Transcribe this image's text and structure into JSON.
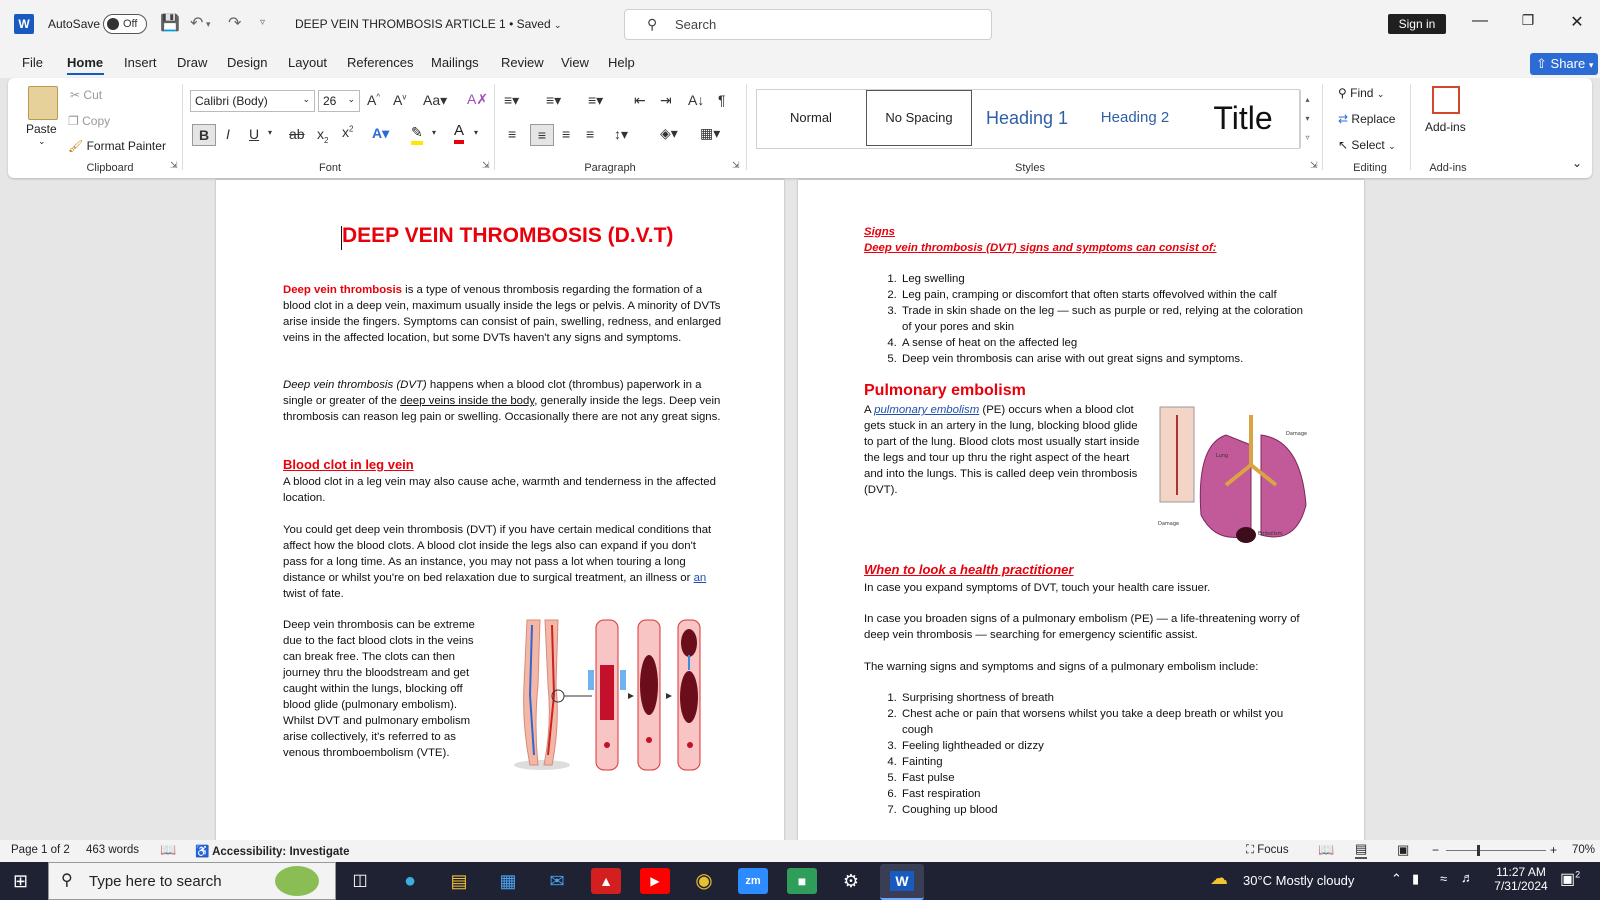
{
  "titlebar": {
    "autosave_label": "AutoSave",
    "autosave_state": "Off",
    "doc_title": "DEEP VEIN THROMBOSIS ARTICLE 1 • Saved",
    "search_placeholder": "Search",
    "signin": "Sign in"
  },
  "menu": [
    "File",
    "Home",
    "Insert",
    "Draw",
    "Design",
    "Layout",
    "References",
    "Mailings",
    "Review",
    "View",
    "Help"
  ],
  "share": "Share",
  "ribbon": {
    "clipboard": {
      "paste": "Paste",
      "cut": "Cut",
      "copy": "Copy",
      "format_painter": "Format Painter",
      "label": "Clipboard"
    },
    "font": {
      "name": "Calibri (Body)",
      "size": "26",
      "label": "Font"
    },
    "paragraph": {
      "label": "Paragraph"
    },
    "styles": {
      "items": [
        "Normal",
        "No Spacing",
        "Heading 1",
        "Heading 2",
        "Title"
      ],
      "label": "Styles"
    },
    "editing": {
      "find": "Find",
      "replace": "Replace",
      "select": "Select",
      "label": "Editing"
    },
    "addins": {
      "button": "Add-ins",
      "label": "Add-ins"
    }
  },
  "page1": {
    "title": "DEEP VEIN THROMBOSIS (D.V.T)",
    "p1_lead": "Deep vein thrombosis",
    "p1_rest": " is a type of venous thrombosis regarding the formation of a blood clot in a deep vein, maximum usually inside the legs or pelvis. A minority of DVTs arise inside the fingers. Symptoms can consist of pain, swelling, redness, and enlarged veins in the affected location, but some DVTs haven't any signs and symptoms.",
    "p2_italic": "Deep vein thrombosis (DVT)",
    "p2_a": " happens when a blood clot (thrombus) paperwork in a single or greater of the ",
    "p2_link": "deep veins inside the body",
    "p2_b": ", generally inside the legs. Deep vein thrombosis can reason leg pain or swelling. Occasionally there are not any great signs.",
    "h_clot": "Blood clot in leg vein",
    "p3": "A blood clot in a leg vein may also cause ache, warmth and tenderness in the affected location.",
    "p4_a": "You could get deep vein thrombosis (DVT) if you have certain medical conditions that affect how the blood clots. A blood clot inside the legs also can expand if you don't pass for a long time. As an instance, you may not pass a lot when touring a long distance or whilst you're on bed relaxation due to surgical treatment, an illness or ",
    "p4_link": "an",
    "p4_b": " twist of fate.",
    "p5": "Deep vein thrombosis can be extreme due to the fact blood clots in the veins can break free. The clots can then journey thru the bloodstream and get caught within the lungs, blocking off blood glide (pulmonary embolism). Whilst DVT and pulmonary embolism arise collectively, it's referred to as venous thromboembolism (VTE)."
  },
  "page2": {
    "signs": "Signs",
    "signs_sub": "Deep vein thrombosis (DVT) signs and symptoms can consist of:",
    "list1": [
      "Leg swelling",
      "Leg pain, cramping or discomfort that often starts offevolved within the calf",
      "Trade in skin shade on the leg — such as purple or red, relying at the coloration of your pores and skin",
      "A sense of heat on the affected leg",
      "Deep vein thrombosis can arise with out great signs and symptoms."
    ],
    "pe_heading": "Pulmonary embolism",
    "pe_a": "A ",
    "pe_link": "pulmonary embolism",
    "pe_b": " (PE) occurs when a blood clot gets stuck in an artery in the lung, blocking blood glide to part of the lung. Blood clots most usually start inside the legs and tour up thru the right aspect of the heart and into the lungs. This is called deep vein thrombosis (DVT).",
    "img_label_damage": "Damage",
    "img_label_embolism": "Embolism",
    "img_label_lung": "Lung",
    "when_heading": "When to look a health practitioner",
    "w1": "In case you expand symptoms of DVT, touch your health care issuer.",
    "w2": "In case you broaden signs of a pulmonary embolism (PE) — a life-threatening worry of deep vein thrombosis — searching for emergency scientific assist.",
    "w3": "The warning signs and symptoms and signs of a pulmonary embolism include:",
    "list2": [
      "Surprising shortness of breath",
      "Chest ache or pain that worsens whilst you take a deep breath or whilst you cough",
      "Feeling lightheaded or dizzy",
      "Fainting",
      "Fast pulse",
      "Fast respiration",
      "Coughing up blood"
    ]
  },
  "status": {
    "page": "Page 1 of 2",
    "words": "463 words",
    "accessibility": "Accessibility: Investigate",
    "focus": "Focus",
    "zoom": "70%"
  },
  "taskbar": {
    "search": "Type here to search",
    "weather": "30°C  Mostly cloudy",
    "time": "11:27 AM",
    "date": "7/31/2024",
    "notif": "2"
  },
  "colors": {
    "accent": "#185abd",
    "heading_red": "#e8000b",
    "link_blue": "#1f4fb3"
  }
}
